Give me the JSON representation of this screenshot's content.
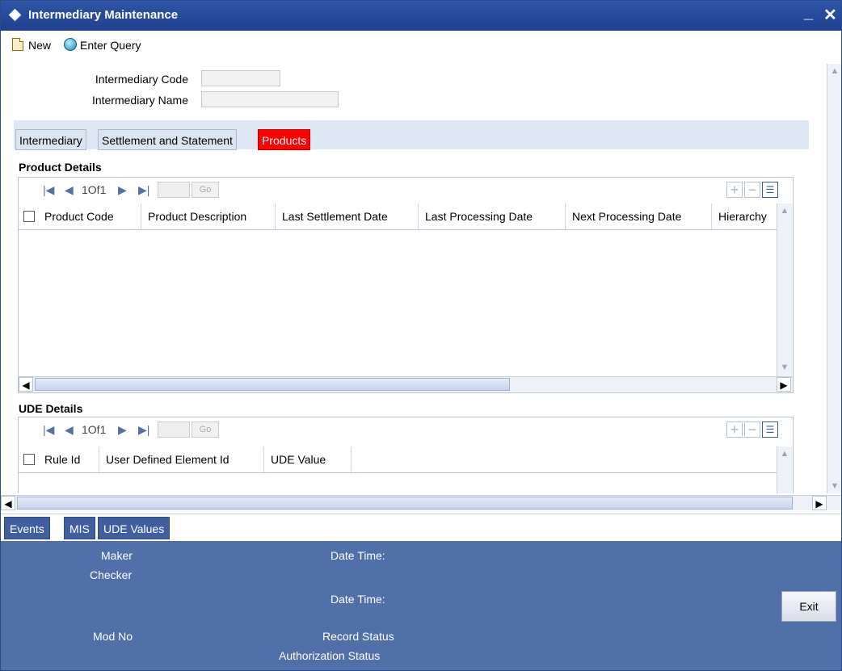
{
  "window": {
    "title": "Intermediary Maintenance",
    "minimize_glyph": "_",
    "close_glyph": "✕"
  },
  "toolbar": {
    "new_label": "New",
    "enter_query_label": "Enter Query"
  },
  "form": {
    "intermediary_code_label": "Intermediary Code",
    "intermediary_code_value": "",
    "intermediary_name_label": "Intermediary Name",
    "intermediary_name_value": ""
  },
  "tabs": [
    {
      "label": "Intermediary",
      "active": false
    },
    {
      "label": "Settlement and Statement",
      "active": false
    },
    {
      "label": "Products",
      "active": true
    }
  ],
  "product_details": {
    "title": "Product Details",
    "pager": {
      "page_text": "1Of1",
      "go_label": "Go"
    },
    "columns": [
      "Product Code",
      "Product Description",
      "Last Settlement Date",
      "Last Processing Date",
      "Next Processing Date",
      "Hierarchy"
    ],
    "rows": []
  },
  "ude_details": {
    "title": "UDE Details",
    "pager": {
      "page_text": "1Of1",
      "go_label": "Go"
    },
    "columns": [
      "Rule Id",
      "User Defined Element Id",
      "UDE Value"
    ],
    "rows": []
  },
  "bottom_tabs": [
    "Events",
    "MIS",
    "UDE Values"
  ],
  "footer": {
    "maker_label": "Maker",
    "checker_label": "Checker",
    "date_time_label_1": "Date Time:",
    "date_time_label_2": "Date Time:",
    "mod_no_label": "Mod No",
    "record_status_label": "Record Status",
    "authorization_status_label": "Authorization Status",
    "exit_label": "Exit"
  },
  "colors": {
    "title_bar": "#2a4f9f",
    "active_tab": "#ff0000",
    "footer_bg": "#5170a9"
  }
}
